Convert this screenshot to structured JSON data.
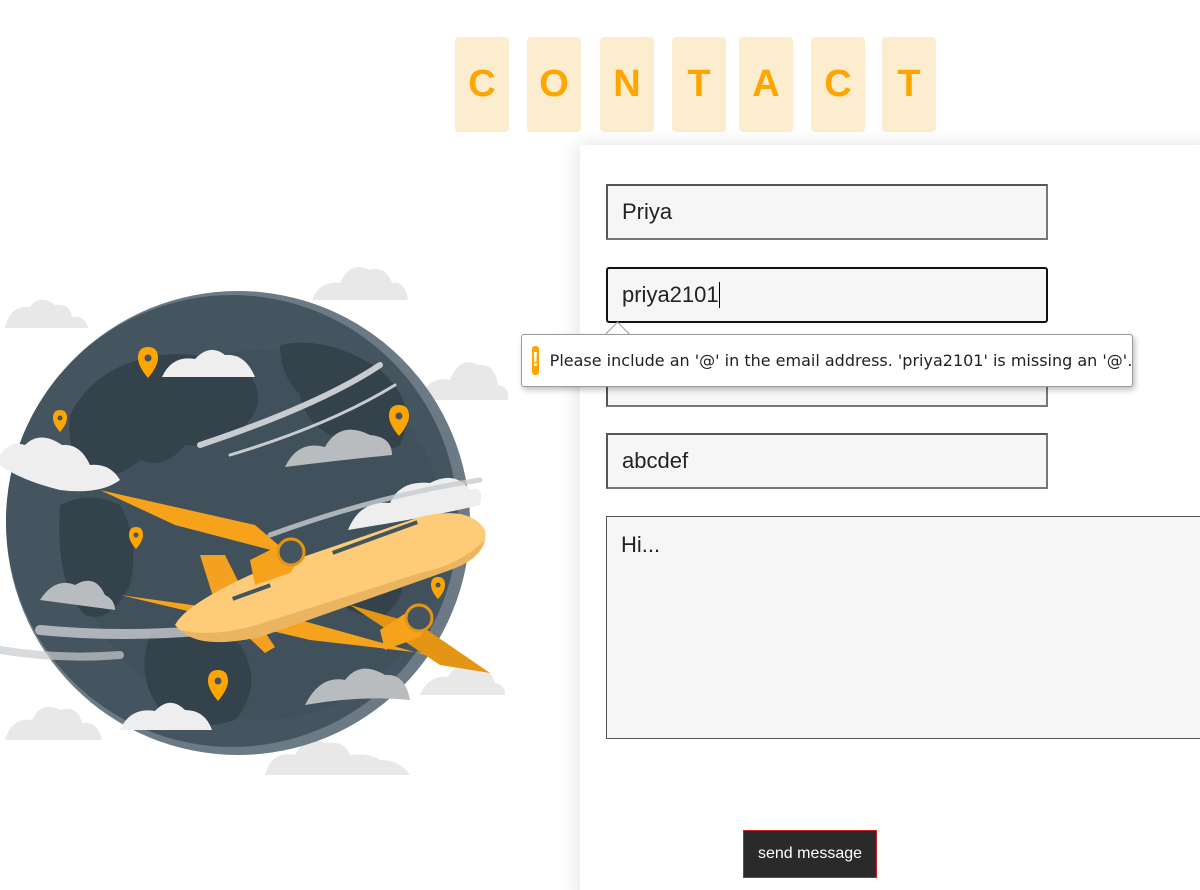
{
  "title": {
    "letters": [
      "C",
      "O",
      "N",
      "T",
      "A",
      "C",
      "T"
    ]
  },
  "form": {
    "name_value": "Priya",
    "email_value": "priya2101",
    "subject_value": "abcdef",
    "message_value": "Hi...",
    "submit_label": "send message"
  },
  "validation": {
    "message": "Please include an '@' in the email address. 'priya2101' is missing an '@'.",
    "icon": "warning-icon"
  },
  "illustration": {
    "description_icon": "globe-airplane-illustration"
  },
  "colors": {
    "accent": "#ffa500",
    "tile_bg": "#fcedcf",
    "globe": "#455560",
    "button_bg": "#2a2a2a"
  }
}
